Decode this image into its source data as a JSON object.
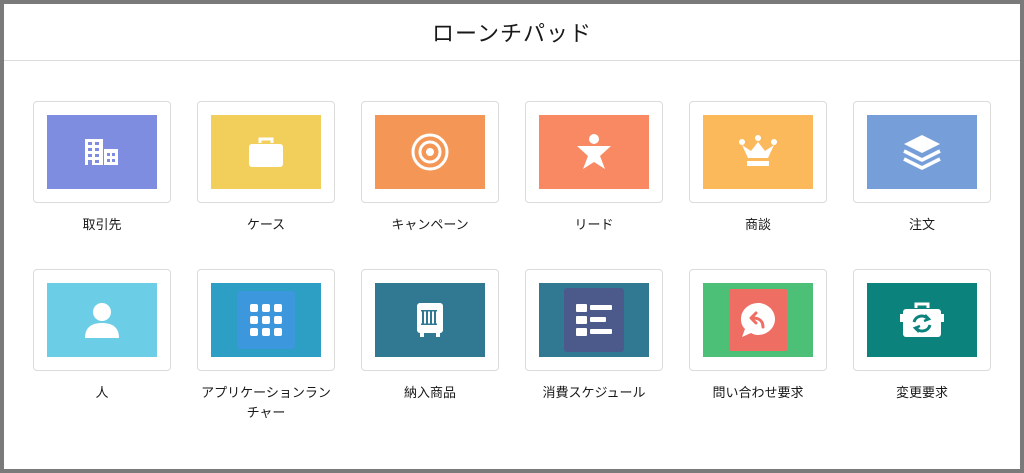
{
  "header": {
    "title": "ローンチパッド"
  },
  "apps": [
    {
      "label": "取引先",
      "icon": "building-icon",
      "color": "#7f8de1"
    },
    {
      "label": "ケース",
      "icon": "briefcase-icon",
      "color": "#f2cf5b"
    },
    {
      "label": "キャンペーン",
      "icon": "target-icon",
      "color": "#f49756"
    },
    {
      "label": "リード",
      "icon": "lead-star-icon",
      "color": "#f88962"
    },
    {
      "label": "商談",
      "icon": "crown-icon",
      "color": "#fcb95b"
    },
    {
      "label": "注文",
      "icon": "layers-icon",
      "color": "#769ed9"
    },
    {
      "label": "人",
      "icon": "person-icon",
      "color": "#6bcee6"
    },
    {
      "label": "アプリケーションランチャー",
      "icon": "app-grid-icon",
      "color": "#2d9fc5",
      "inner_color": "#3c97dd"
    },
    {
      "label": "納入商品",
      "icon": "product-box-icon",
      "color": "#317992"
    },
    {
      "label": "消費スケジュール",
      "icon": "schedule-list-icon",
      "color": "#317992",
      "inner_color": "#4c5a8b"
    },
    {
      "label": "問い合わせ要求",
      "icon": "chat-reply-icon",
      "color": "#4bc076",
      "inner_color": "#ef6e64"
    },
    {
      "label": "変更要求",
      "icon": "toolbox-sync-icon",
      "color": "#0b827c"
    }
  ]
}
